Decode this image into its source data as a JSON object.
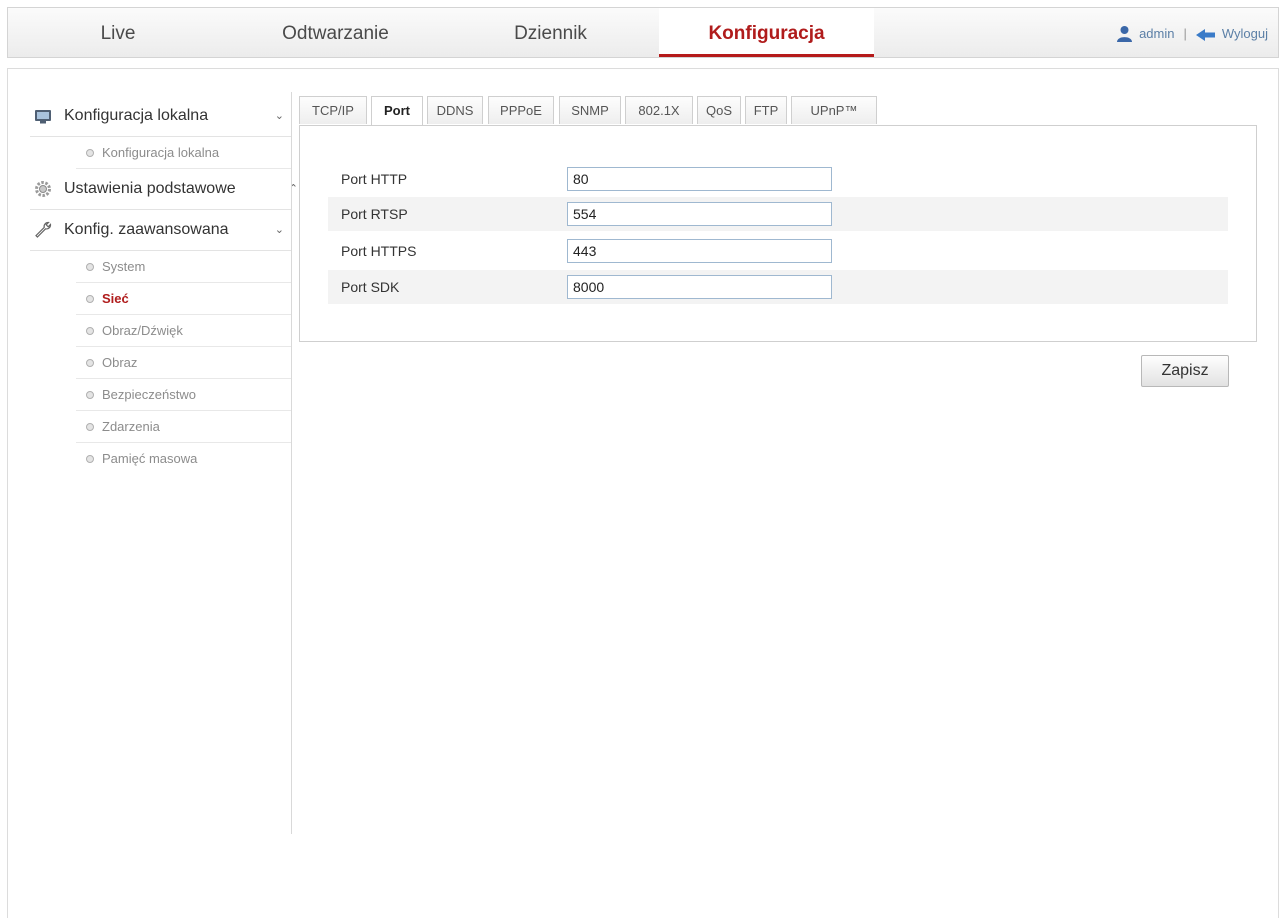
{
  "nav": {
    "tabs": [
      {
        "label": "Live"
      },
      {
        "label": "Odtwarzanie"
      },
      {
        "label": "Dziennik"
      },
      {
        "label": "Konfiguracja"
      }
    ],
    "active_tab": "Konfiguracja",
    "user": "admin",
    "separator": "|",
    "logout": "Wyloguj"
  },
  "sidebar": {
    "local": {
      "label": "Konfiguracja lokalna",
      "chevron": "⌄",
      "items": [
        {
          "label": "Konfiguracja lokalna"
        }
      ]
    },
    "basic": {
      "label": "Ustawienia podstawowe",
      "chevron": "⌃"
    },
    "advanced": {
      "label": "Konfig. zaawansowana",
      "chevron": "⌄",
      "items": [
        {
          "label": "System"
        },
        {
          "label": "Sieć"
        },
        {
          "label": "Obraz/Dźwięk"
        },
        {
          "label": "Obraz"
        },
        {
          "label": "Bezpieczeństwo"
        },
        {
          "label": "Zdarzenia"
        },
        {
          "label": "Pamięć masowa"
        }
      ],
      "active_item": "Sieć"
    }
  },
  "tabs": [
    {
      "label": "TCP/IP"
    },
    {
      "label": "Port"
    },
    {
      "label": "DDNS"
    },
    {
      "label": "PPPoE"
    },
    {
      "label": "SNMP"
    },
    {
      "label": "802.1X"
    },
    {
      "label": "QoS"
    },
    {
      "label": "FTP"
    },
    {
      "label": "UPnP™"
    }
  ],
  "active_tab": "Port",
  "form": {
    "rows": [
      {
        "label": "Port HTTP",
        "value": "80"
      },
      {
        "label": "Port RTSP",
        "value": "554"
      },
      {
        "label": "Port HTTPS",
        "value": "443"
      },
      {
        "label": "Port SDK",
        "value": "8000"
      }
    ]
  },
  "save_label": "Zapisz",
  "colors": {
    "accent": "#b01c1c",
    "link": "#5b7fa6"
  }
}
